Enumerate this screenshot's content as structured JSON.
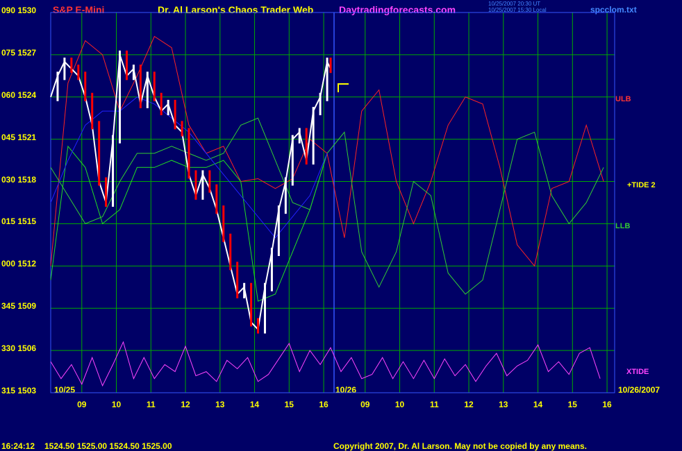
{
  "header": {
    "instrument": "S&P E-Mini",
    "web_title": "Dr. Al Larson's Chaos Trader Web",
    "site": "Daytradingforecasts.com",
    "stamp_line1": "10/25/2007 20:30 UT",
    "stamp_line2": "10/25/2007 15:30 Local",
    "filename": "spcclom.txt"
  },
  "footer": {
    "time": "16:24:12",
    "quote": "1524.50 1525.00 1524.50 1525.00",
    "copyright": "Copyright 2007, Dr. Al Larson. May not be copied by any means."
  },
  "colors": {
    "background": "#000066",
    "grid": "#00aa00",
    "axis_text": "#ffff00",
    "price": "#ffffff",
    "price_down": "#ff0000",
    "ulb": "#ff2222",
    "llb": "#33cc33",
    "tide": "#22dd22",
    "moving_avg": "#2222ff",
    "xtide": "#ff44ff",
    "title_red": "#ff3333",
    "title_yellow": "#ffff00",
    "site_magenta": "#ff44ff",
    "link_blue": "#4488ff"
  },
  "chart_data": {
    "type": "line",
    "y_axis": {
      "angle_labels": [
        "090",
        "075",
        "060",
        "045",
        "030",
        "015",
        "000",
        "345",
        "330",
        "315"
      ],
      "price_labels": [
        "1530",
        "1527",
        "1524",
        "1521",
        "1518",
        "1515",
        "1512",
        "1509",
        "1506",
        "1503"
      ],
      "price_range": [
        1503,
        1530
      ]
    },
    "x_axis": {
      "hour_labels": [
        "09",
        "10",
        "11",
        "12",
        "13",
        "14",
        "15",
        "16",
        "09",
        "10",
        "11",
        "12",
        "13",
        "14",
        "15",
        "16"
      ],
      "date_labels": [
        "10/25",
        "10/26",
        "10/26/2007"
      ],
      "range_hours": [
        8.1,
        16.3,
        8.1,
        16.3
      ]
    },
    "series_labels": {
      "ulb": "ULB",
      "tide": "+TIDE 2",
      "llb": "LLB",
      "xtide": "XTIDE"
    },
    "series": [
      {
        "name": "ULB",
        "x": [
          8.1,
          8.6,
          9.1,
          9.6,
          10.1,
          10.6,
          11.1,
          11.6,
          12.1,
          12.6,
          13.1,
          13.6,
          14.1,
          14.6,
          15.1,
          15.6,
          16.1,
          16.6,
          17.1,
          17.6,
          18.1,
          18.6,
          19.1,
          19.6,
          20.1,
          20.6,
          21.1,
          21.6,
          22.1,
          22.6,
          23.1,
          23.6,
          24.1
        ],
        "y": [
          1512.0,
          1525.0,
          1528.0,
          1527.0,
          1523.0,
          1525.5,
          1528.3,
          1527.5,
          1522.0,
          1520.0,
          1520.5,
          1518.0,
          1518.2,
          1517.5,
          1518.2,
          1521.0,
          1520.0,
          1514.0,
          1523.0,
          1524.5,
          1518.0,
          1515.0,
          1518.0,
          1522.0,
          1524.0,
          1523.5,
          1519.0,
          1513.5,
          1512.0,
          1517.5,
          1518.0,
          1522.0,
          1518.0
        ]
      },
      {
        "name": "LLB",
        "x": [
          8.1,
          8.6,
          9.1,
          9.6,
          10.1,
          10.6,
          11.1,
          11.6,
          12.1,
          12.6,
          13.1,
          13.6,
          14.1,
          14.6,
          15.1,
          15.6,
          16.1,
          16.6,
          17.1,
          17.6,
          18.1,
          18.6,
          19.1,
          19.6,
          20.1,
          20.6,
          21.1,
          21.6,
          22.1,
          22.6,
          23.1,
          23.6,
          24.1
        ],
        "y": [
          1519.0,
          1517.0,
          1515.0,
          1515.5,
          1518.0,
          1520.0,
          1520.0,
          1520.5,
          1520.0,
          1519.5,
          1520.0,
          1522.0,
          1522.5,
          1519.5,
          1516.5,
          1516.0,
          1520.0,
          1521.5,
          1513.0,
          1510.5,
          1513.0,
          1518.0,
          1517.0,
          1511.5,
          1510.0,
          1511.0,
          1516.0,
          1521.0,
          1521.5,
          1517.0,
          1515.0,
          1516.5,
          1519.0
        ]
      },
      {
        "name": "+TIDE 2",
        "x": [
          8.1,
          8.6,
          9.1,
          9.6,
          10.1,
          10.6,
          11.1,
          11.6,
          12.1,
          12.6,
          13.1,
          13.6,
          14.1,
          14.6,
          15.1,
          15.6,
          16.1
        ],
        "y": [
          1511.0,
          1520.5,
          1519.0,
          1515.0,
          1516.0,
          1519.0,
          1519.0,
          1519.5,
          1519.0,
          1519.0,
          1519.5,
          1518.0,
          1509.5,
          1510.0,
          1513.0,
          1516.0,
          1520.0
        ]
      },
      {
        "name": "Moving average",
        "x": [
          8.1,
          8.6,
          9.1,
          9.6,
          10.1,
          10.6,
          11.1,
          11.6,
          12.1,
          12.6,
          13.1,
          13.6,
          14.1,
          14.6,
          15.1,
          15.6,
          16.1
        ],
        "y": [
          1516.5,
          1519.5,
          1522.0,
          1523.0,
          1523.0,
          1524.0,
          1523.5,
          1522.5,
          1521.5,
          1520.0,
          1518.5,
          1517.0,
          1515.5,
          1514.0,
          1515.5,
          1517.0,
          1520.0
        ]
      },
      {
        "name": "Price",
        "x": [
          8.1,
          8.3,
          8.5,
          8.7,
          8.9,
          9.1,
          9.3,
          9.5,
          9.7,
          9.9,
          10.1,
          10.3,
          10.5,
          10.7,
          10.9,
          11.1,
          11.3,
          11.5,
          11.7,
          11.9,
          12.1,
          12.3,
          12.5,
          12.7,
          12.9,
          13.1,
          13.3,
          13.5,
          13.7,
          13.9,
          14.1,
          14.3,
          14.5,
          14.7,
          14.9,
          15.1,
          15.3,
          15.5,
          15.7,
          15.9,
          16.1,
          16.2
        ],
        "y": [
          1524.0,
          1525.5,
          1526.5,
          1526.0,
          1525.5,
          1524.0,
          1522.0,
          1518.0,
          1516.5,
          1521.0,
          1527.0,
          1525.5,
          1526.0,
          1523.5,
          1525.5,
          1524.0,
          1523.0,
          1523.5,
          1522.0,
          1521.5,
          1518.5,
          1517.0,
          1518.5,
          1517.5,
          1516.0,
          1514.0,
          1512.0,
          1510.0,
          1510.5,
          1508.0,
          1507.5,
          1510.5,
          1513.0,
          1516.0,
          1518.0,
          1521.0,
          1521.5,
          1519.5,
          1523.0,
          1524.0,
          1526.5,
          1526.0
        ]
      },
      {
        "name": "XTIDE",
        "x": [
          8.1,
          8.4,
          8.7,
          9.0,
          9.3,
          9.6,
          9.9,
          10.2,
          10.5,
          10.8,
          11.1,
          11.4,
          11.7,
          12.0,
          12.3,
          12.6,
          12.9,
          13.2,
          13.5,
          13.8,
          14.1,
          14.4,
          14.7,
          15.0,
          15.3,
          15.6,
          15.9,
          16.2,
          16.5,
          16.8,
          17.1,
          17.4,
          17.7,
          18.0,
          18.3,
          18.6,
          18.9,
          19.2,
          19.5,
          19.8,
          20.1,
          20.4,
          20.7,
          21.0,
          21.3,
          21.6,
          21.9,
          22.2,
          22.5,
          22.8,
          23.1,
          23.4,
          23.7,
          24.0
        ],
        "y": [
          1505.2,
          1504.0,
          1505.0,
          1503.6,
          1505.5,
          1503.5,
          1505.0,
          1506.6,
          1504.0,
          1505.5,
          1504.0,
          1505.0,
          1504.5,
          1506.3,
          1504.2,
          1504.5,
          1503.8,
          1505.3,
          1504.7,
          1505.5,
          1503.8,
          1504.3,
          1505.4,
          1506.5,
          1504.5,
          1506.0,
          1505.0,
          1506.2,
          1504.5,
          1505.5,
          1504.0,
          1504.3,
          1505.5,
          1504.0,
          1505.2,
          1504.0,
          1505.3,
          1504.0,
          1505.4,
          1504.2,
          1505.0,
          1503.8,
          1504.9,
          1505.8,
          1504.2,
          1504.9,
          1505.3,
          1506.4,
          1504.5,
          1505.2,
          1504.3,
          1505.8,
          1506.2,
          1504.0
        ]
      }
    ]
  }
}
